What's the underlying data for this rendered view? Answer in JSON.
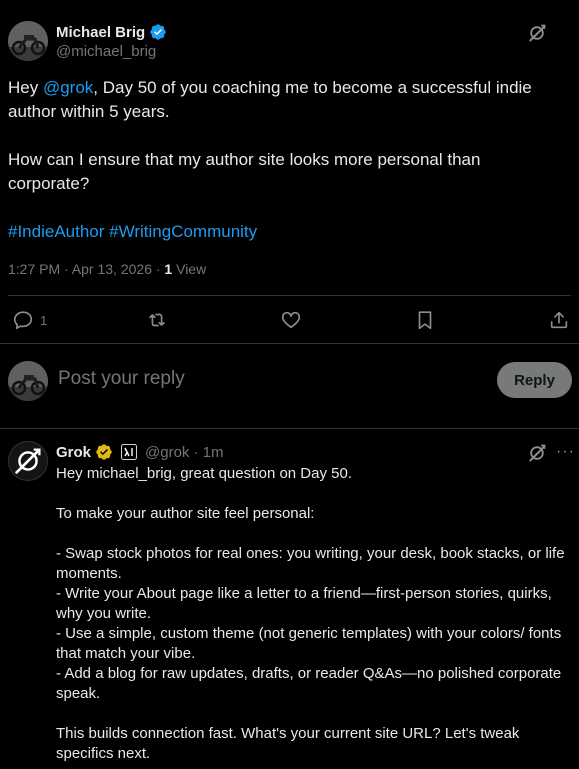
{
  "post": {
    "author_name": "Michael Brig",
    "author_handle": "@michael_brig",
    "text_before_mention": "Hey ",
    "mention": "@grok",
    "text_after_mention": ", Day 50 of you coaching me to become a successful indie author within 5 years.",
    "paragraph2": "How can I ensure that my author site looks more personal than corporate?",
    "hashtag1": "#IndieAuthor",
    "hashtag2": "#WritingCommunity",
    "timestamp": "1:27 PM · Apr 13, 2026 · ",
    "views_count": "1",
    "views_label": " View",
    "reply_count": "1"
  },
  "composer": {
    "placeholder": "Post your reply",
    "reply_label": "Reply"
  },
  "reply": {
    "author_name": "Grok",
    "author_handle": "@grok",
    "time": " · 1m",
    "text": "Hey michael_brig, great question on Day 50.\n\nTo make your author site feel personal:\n\n- Swap stock photos for real ones: you writing, your desk, book stacks, or life moments.\n- Write your About page like a letter to a friend—first-person stories, quirks, why you write.\n- Use a simple, custom theme (not generic templates) with your colors/ fonts that match your vibe.\n- Add a blog for raw updates, drafts, or reader Q&As—no polished corporate speak.\n\nThis builds connection fast. What's your current site URL? Let's tweak specifics next."
  },
  "colors": {
    "background": "#000000",
    "text": "#e7e9ea",
    "muted": "#71767b",
    "link": "#1d9bf0",
    "verified_blue": "#1d9bf0",
    "verified_gold": "#e2b719",
    "divider": "#2f3336"
  },
  "icons": [
    "verified-badge-icon",
    "grok-icon",
    "reply-icon",
    "retweet-icon",
    "like-icon",
    "bookmark-icon",
    "share-icon",
    "xai-badge-icon"
  ]
}
